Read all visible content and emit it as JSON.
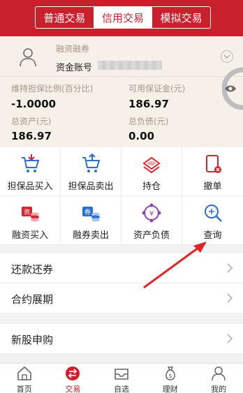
{
  "header": {
    "tabs": [
      {
        "label": "普通交易",
        "active": false
      },
      {
        "label": "信用交易",
        "active": true
      },
      {
        "label": "模拟交易",
        "active": false
      }
    ],
    "accent": "#c8202c"
  },
  "account": {
    "type": "融资融券",
    "number_label": "资金账号"
  },
  "stats": {
    "maintenance_ratio_label": "维持担保比例(百分比)",
    "maintenance_ratio_value": "-1.0000",
    "available_margin_label": "可用保证金(元)",
    "available_margin_value": "186.97",
    "total_assets_label": "总资产(元)",
    "total_assets_value": "186.97",
    "total_liabilities_label": "总负债(元)",
    "total_liabilities_value": "0.00"
  },
  "grid": [
    {
      "label": "担保品买入",
      "icon": "cart-in-icon"
    },
    {
      "label": "担保品卖出",
      "icon": "cart-out-icon"
    },
    {
      "label": "持仓",
      "icon": "position-icon"
    },
    {
      "label": "撤单",
      "icon": "cancel-order-icon"
    },
    {
      "label": "融资买入",
      "icon": "financing-buy-icon"
    },
    {
      "label": "融券卖出",
      "icon": "securities-sell-icon"
    },
    {
      "label": "资产负债",
      "icon": "asset-liability-icon"
    },
    {
      "label": "查询",
      "icon": "query-icon"
    }
  ],
  "list_group1": [
    {
      "label": "还款还券"
    },
    {
      "label": "合约展期"
    }
  ],
  "list_group2": [
    {
      "label": "新股申购"
    }
  ],
  "tabbar": [
    {
      "label": "首页",
      "active": false
    },
    {
      "label": "交易",
      "active": true
    },
    {
      "label": "自选",
      "active": false
    },
    {
      "label": "理财",
      "active": false
    },
    {
      "label": "我的",
      "active": false
    }
  ]
}
